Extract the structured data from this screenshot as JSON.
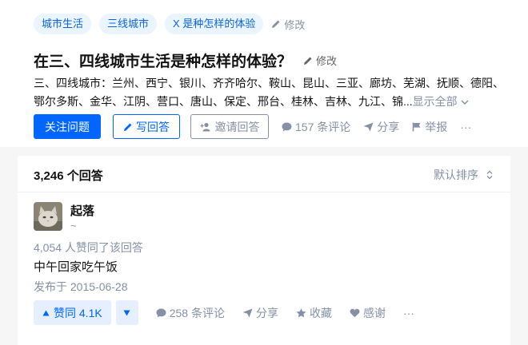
{
  "topics": [
    "城市生活",
    "三线城市",
    "X 是种怎样的体验"
  ],
  "topic_edit_label": "修改",
  "question": {
    "title": "在三、四线城市生活是种怎样的体验？",
    "edit_label": "修改",
    "detail": "三、四线城市：兰州、西宁、银川、齐齐哈尔、鞍山、昆山、三亚、廊坊、芜湖、抚顺、德阳、鄂尔多斯、金华、江阴、营口、唐山、保定、邢台、桂林、吉林、九江、锦...",
    "show_all": "显示全部"
  },
  "actions": {
    "follow": "关注问题",
    "write": "写回答",
    "invite": "邀请回答",
    "comments": "157 条评论",
    "share": "分享",
    "report": "举报",
    "more": "···"
  },
  "answers": {
    "count_label": "3,246 个回答",
    "sort_label": "默认排序"
  },
  "answer": {
    "author": "起落",
    "author_sub": "~",
    "voters": "4,054 人赞同了该回答",
    "content": "中午回家吃午饭",
    "published": "发布于 2015-06-28",
    "upvote": "赞同 4.1K",
    "comments": "258 条评论",
    "share": "分享",
    "collect": "收藏",
    "thanks": "感谢",
    "more": "···"
  },
  "colors": {
    "brand": "#0066ff",
    "tag_bg": "#ebf5ff",
    "muted": "#8590a6"
  }
}
